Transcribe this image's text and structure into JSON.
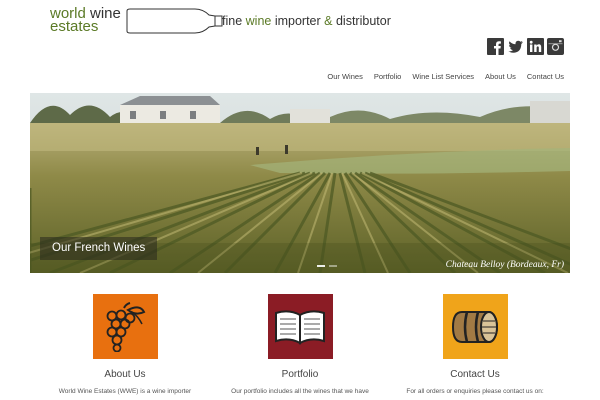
{
  "brand": {
    "logo_line1a": "world",
    "logo_line1b": "wine",
    "logo_line2": "estates",
    "tagline_a": "fine ",
    "tagline_b": "wine",
    "tagline_c": " importer ",
    "tagline_d": "&",
    "tagline_e": " distributor",
    "green": "#5b7a26"
  },
  "social": [
    "facebook-icon",
    "twitter-icon",
    "linkedin-icon",
    "instagram-icon"
  ],
  "nav": {
    "items": [
      "Our Wines",
      "Portfolio",
      "Wine List Services",
      "About Us",
      "Contact Us"
    ]
  },
  "hero": {
    "caption": "Our French Wines",
    "credit": "Chateau Belloy (Bordeaux, Fr)",
    "slides_total": 2,
    "active_slide": 1
  },
  "features": [
    {
      "title": "About Us",
      "text": "World Wine Estates (WWE) is a wine importer",
      "icon": "grapes-icon",
      "color": "#e8700f"
    },
    {
      "title": "Portfolio",
      "text": "Our portfolio includes all the wines that we have",
      "icon": "book-icon",
      "color": "#8b1c25"
    },
    {
      "title": "Contact Us",
      "text": "For all orders or enquiries please contact us on:",
      "icon": "barrel-icon",
      "color": "#f0a41a"
    }
  ]
}
